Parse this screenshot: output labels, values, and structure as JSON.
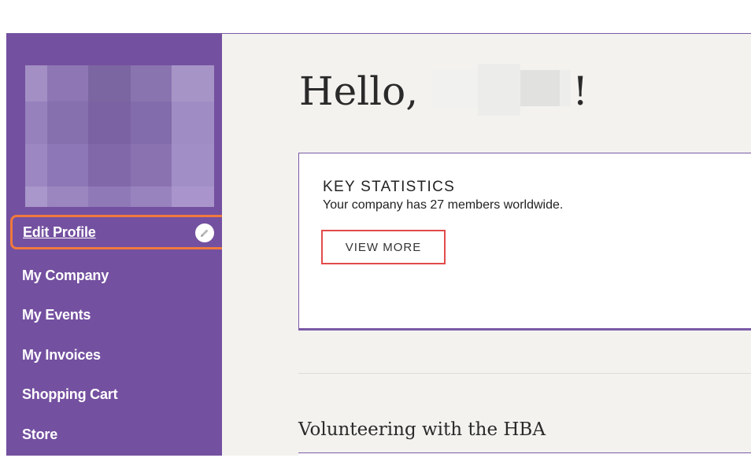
{
  "sidebar": {
    "items": [
      {
        "label": "Edit Profile",
        "icon": "pencil-icon"
      },
      {
        "label": "My Company"
      },
      {
        "label": "My Events"
      },
      {
        "label": "My Invoices"
      },
      {
        "label": "Shopping Cart"
      },
      {
        "label": "Store"
      }
    ]
  },
  "main": {
    "greeting_prefix": "Hello,",
    "greeting_suffix": "!",
    "key_statistics": {
      "title": "KEY STATISTICS",
      "subtitle": "Your company has 27 members worldwide.",
      "button_label": "VIEW MORE"
    },
    "volunteering_heading": "Volunteering with the HBA"
  },
  "colors": {
    "sidebar_bg": "#7450a0",
    "main_bg": "#f3f2ef",
    "highlight_orange": "#f07a3c",
    "highlight_red": "#e24b4b",
    "accent_purple": "#7a5aa6"
  }
}
